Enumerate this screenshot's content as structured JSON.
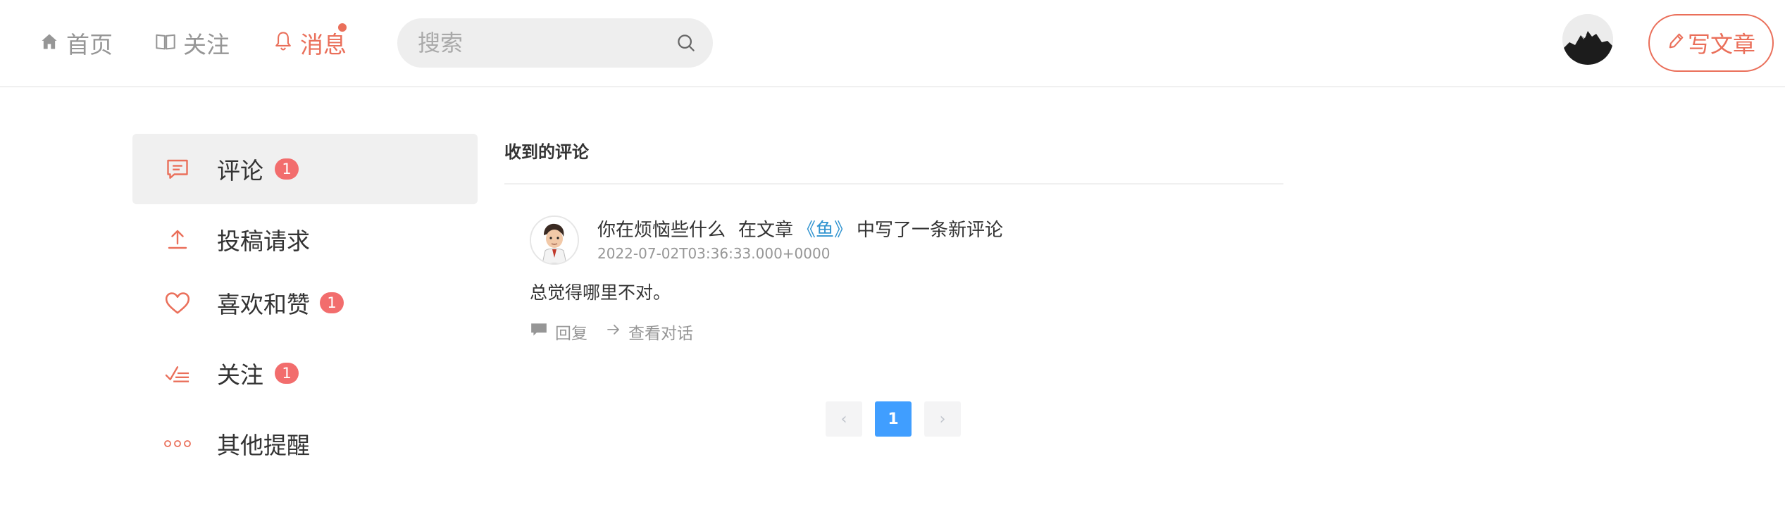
{
  "nav": {
    "home": "首页",
    "follow": "关注",
    "messages": "消息"
  },
  "search": {
    "placeholder": "搜索"
  },
  "header": {
    "write_label": "写文章"
  },
  "sidebar": {
    "items": [
      {
        "label": "评论",
        "badge": "1",
        "icon": "comment-icon",
        "active": true
      },
      {
        "label": "投稿请求",
        "badge": "",
        "icon": "upload-icon",
        "active": false
      },
      {
        "label": "喜欢和赞",
        "badge": "1",
        "icon": "heart-icon",
        "active": false
      },
      {
        "label": "关注",
        "badge": "1",
        "icon": "checklist-icon",
        "active": false
      },
      {
        "label": "其他提醒",
        "badge": "",
        "icon": "more-dots-icon",
        "active": false
      }
    ]
  },
  "main": {
    "title": "收到的评论",
    "comments": [
      {
        "user": "你在烦恼些什么",
        "action_prefix": "在文章",
        "article": "《鱼》",
        "action_suffix": "中写了一条新评论",
        "time": "2022-07-02T03:36:33.000+0000",
        "content": "总觉得哪里不对。",
        "reply_label": "回复",
        "view_label": "查看对话"
      }
    ],
    "pagination": {
      "prev": "‹",
      "current": "1",
      "next": "›"
    }
  },
  "colors": {
    "accent": "#ea6f5a",
    "badge": "#f26d6d",
    "link": "#3194d0",
    "page_active": "#409eff"
  }
}
